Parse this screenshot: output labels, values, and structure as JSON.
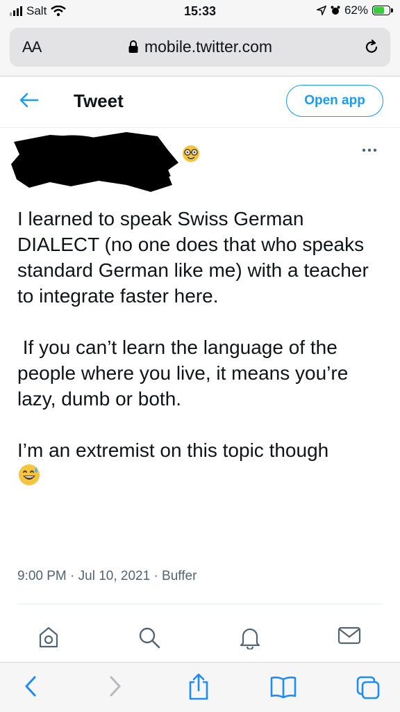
{
  "status": {
    "carrier": "Salt",
    "time": "15:33",
    "battery": "62%",
    "battery_level": 0.62
  },
  "browser": {
    "aa_label": "AA",
    "url": "mobile.twitter.com"
  },
  "header": {
    "title": "Tweet",
    "open_app": "Open app"
  },
  "tweet": {
    "paragraph1": "I learned to speak Swiss German DIALECT (no one does that who speaks standard German like me) with a teacher to integrate faster here.",
    "paragraph2": " If you can’t learn the language of the people where you live, it means you’re lazy, dumb or both.",
    "paragraph3": "I’m an extremist on this topic though",
    "meta": "9:00 PM · Jul 10, 2021 · Buffer"
  },
  "colors": {
    "accent": "#1d9bf0",
    "text": "#0f1419",
    "muted": "#536471"
  },
  "icons": {
    "retweet": "retweet-icon",
    "search": "search-icon",
    "notifications": "bell-icon",
    "messages": "mail-icon"
  }
}
